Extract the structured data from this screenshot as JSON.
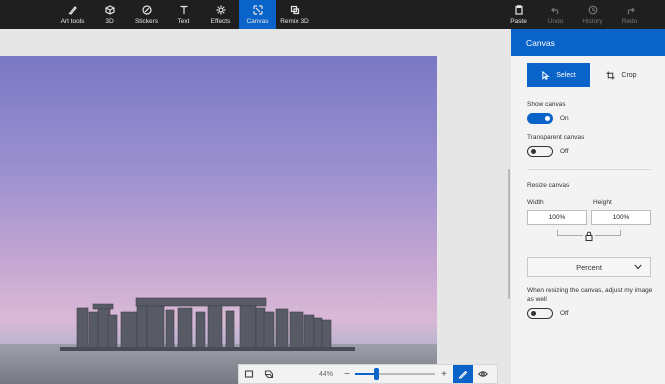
{
  "toolbar": {
    "tools": [
      {
        "label": "Art tools",
        "icon": "brush-icon"
      },
      {
        "label": "3D",
        "icon": "cube-icon"
      },
      {
        "label": "Stickers",
        "icon": "sticker-icon"
      },
      {
        "label": "Text",
        "icon": "text-icon"
      },
      {
        "label": "Effects",
        "icon": "sun-icon"
      },
      {
        "label": "Canvas",
        "icon": "canvas-icon"
      },
      {
        "label": "Remix 3D",
        "icon": "remix-icon"
      }
    ],
    "active_tool": "Canvas",
    "actions": [
      {
        "label": "Paste",
        "icon": "paste-icon",
        "enabled": true
      },
      {
        "label": "Undo",
        "icon": "undo-icon",
        "enabled": false
      },
      {
        "label": "History",
        "icon": "history-icon",
        "enabled": false
      },
      {
        "label": "Redo",
        "icon": "redo-icon",
        "enabled": false
      }
    ]
  },
  "panel": {
    "title": "Canvas",
    "select_label": "Select",
    "crop_label": "Crop",
    "show_canvas_label": "Show canvas",
    "show_canvas_state": "On",
    "transparent_canvas_label": "Transparent canvas",
    "transparent_canvas_state": "Off",
    "resize_label": "Resize canvas",
    "width_label": "Width",
    "height_label": "Height",
    "width_value": "100%",
    "height_value": "100%",
    "unit_value": "Percent",
    "adjust_note": "When resizing the canvas, adjust my image as well",
    "adjust_state": "Off"
  },
  "zoom": {
    "percent_label": "44%",
    "minus": "−",
    "plus": "+",
    "level": 0.26
  },
  "colors": {
    "accent": "#0a63c9",
    "toolbar_bg": "#1f1f1f",
    "panel_bg": "#f3f3f3",
    "workspace_bg": "#e6e6e6"
  }
}
